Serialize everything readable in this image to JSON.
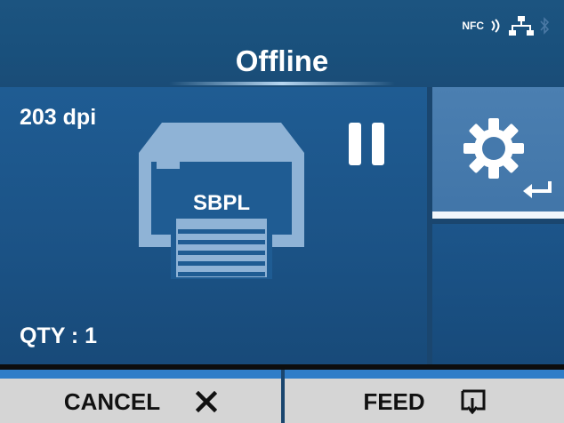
{
  "header": {
    "title": "Offline",
    "status_icons": {
      "nfc_label": "NFC",
      "nfc_icon": "nfc-signal-icon",
      "network_icon": "wired-network-icon",
      "bluetooth_icon": "bluetooth-icon"
    }
  },
  "main": {
    "resolution": "203 dpi",
    "printer_language": "SBPL",
    "quantity": "QTY : 1",
    "printer_icon": "printer-icon",
    "state_icon": "pause-icon"
  },
  "side": {
    "settings_icon": "gear-icon",
    "enter_icon": "enter-arrow-icon"
  },
  "softkeys": {
    "cancel_label": "CANCEL",
    "cancel_icon": "close-icon",
    "feed_label": "FEED",
    "feed_icon": "feed-icon"
  },
  "colors": {
    "header_bg": "#1c5480",
    "panel_bg": "#1f5c93",
    "settings_tile": "#4b7fb1",
    "softkey_bg": "#d5d5d5",
    "softkey_accent": "#2f7dc8",
    "printer_icon": "#8fb3d6"
  }
}
